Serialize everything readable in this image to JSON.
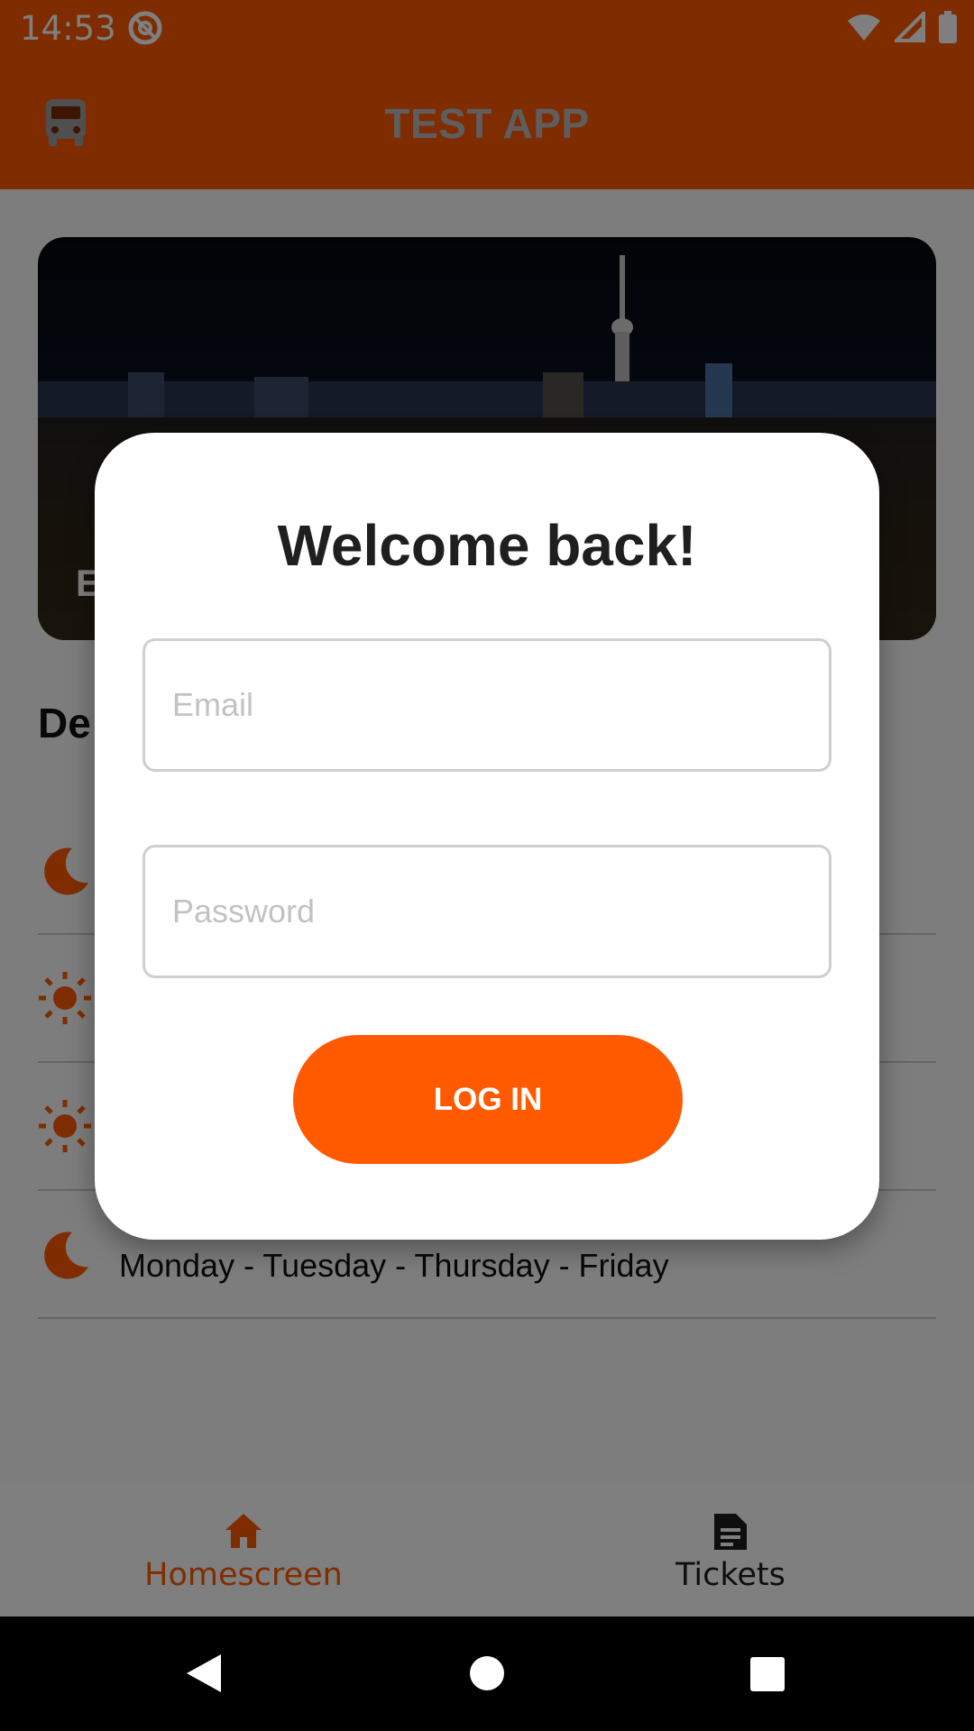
{
  "status_bar": {
    "time": "14:53"
  },
  "app_bar": {
    "title": "TEST APP"
  },
  "banner": {
    "caption_partial": "E"
  },
  "section": {
    "title_partial": "De"
  },
  "departures": [
    {
      "icon": "moon-icon",
      "days": ""
    },
    {
      "icon": "sun-icon",
      "days": ""
    },
    {
      "icon": "sun-icon",
      "days": ""
    },
    {
      "icon": "moon-icon",
      "days": "Monday - Tuesday - Thursday - Friday"
    }
  ],
  "bottom_nav": {
    "items": [
      {
        "label": "Homescreen",
        "icon": "home-icon",
        "active": true
      },
      {
        "label": "Tickets",
        "icon": "document-icon",
        "active": false
      }
    ]
  },
  "dialog": {
    "title": "Welcome back!",
    "email_placeholder": "Email",
    "password_placeholder": "Password",
    "login_label": "LOG IN"
  },
  "colors": {
    "accent": "#ff5a00",
    "scrim": "#000000"
  }
}
